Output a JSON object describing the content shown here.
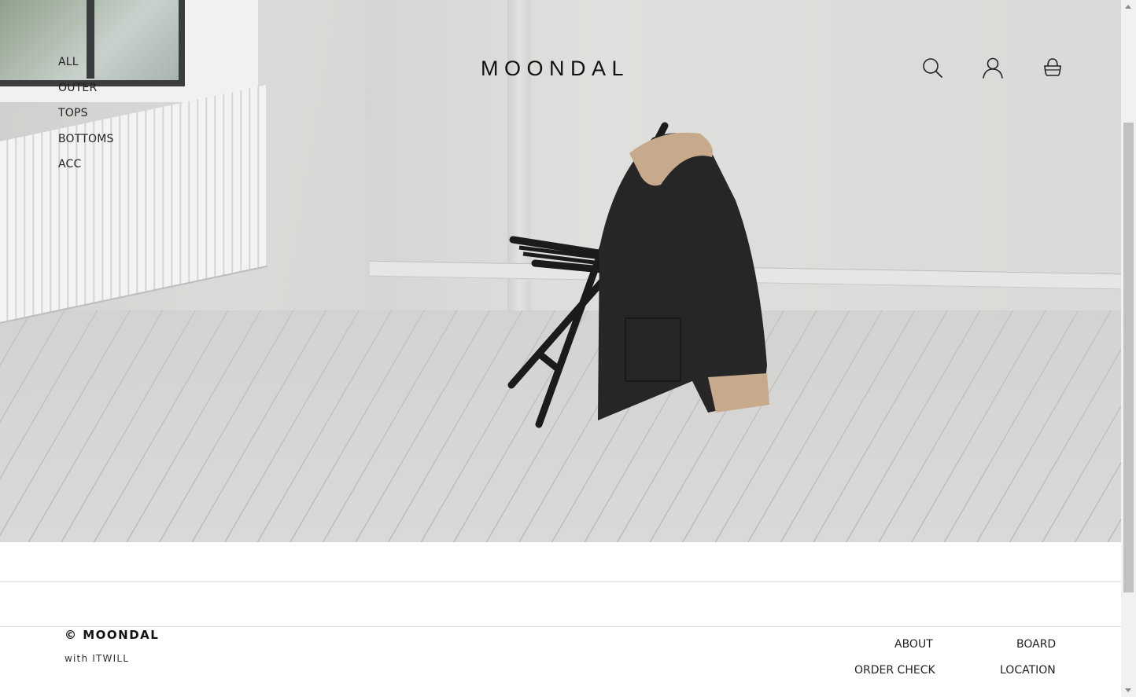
{
  "brand": {
    "logo": "MOONDAL"
  },
  "category_nav": [
    {
      "label": "ALL"
    },
    {
      "label": "OUTER"
    },
    {
      "label": "TOPS"
    },
    {
      "label": "BOTTOMS"
    },
    {
      "label": "ACC"
    }
  ],
  "header_icons": {
    "search": "search-icon",
    "account": "user-icon",
    "cart": "shopping-bag-icon"
  },
  "hero": {
    "alt": ""
  },
  "footer": {
    "copyright": "© MOONDAL",
    "with": "with ITWILL",
    "links": {
      "about": "ABOUT",
      "board": "BOARD",
      "order_check": "ORDER CHECK",
      "location": "LOCATION"
    }
  }
}
